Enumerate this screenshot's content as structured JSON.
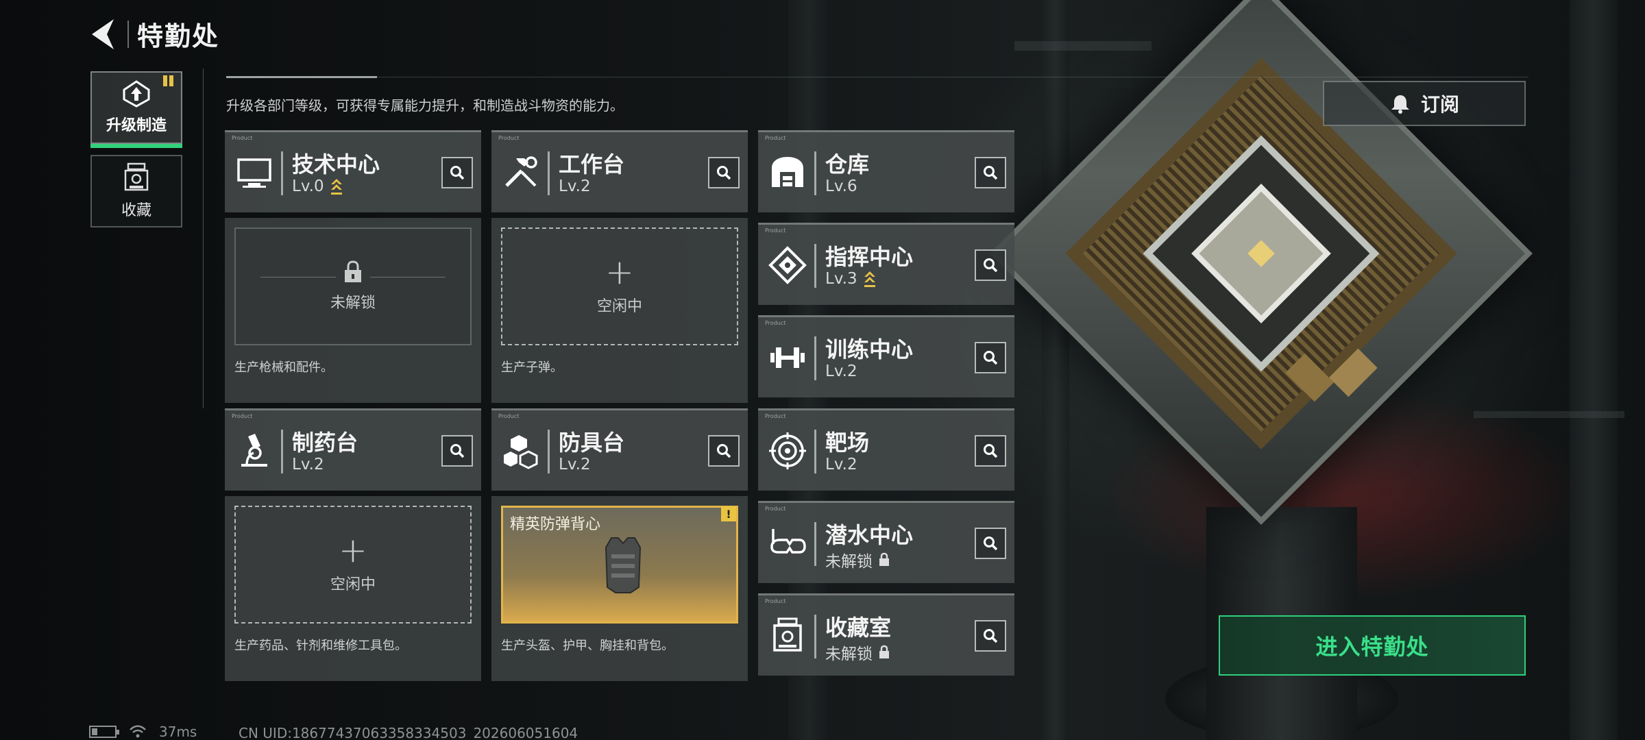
{
  "header": {
    "title": "特勤处"
  },
  "tabs": [
    {
      "label": "升级制造",
      "icon": "upgrade-icon",
      "active": true,
      "badge": true
    },
    {
      "label": "收藏",
      "icon": "collection-icon",
      "active": false
    }
  ],
  "subtitle": "升级各部门等级，可获得专属能力提升，和制造战斗物资的能力。",
  "subscribe": {
    "label": "订阅",
    "icon": "bell-icon"
  },
  "departments": {
    "tech": {
      "name": "技术中心",
      "level": "Lv.0",
      "upgradable": true,
      "slot": {
        "state": "locked",
        "text": "未解锁"
      },
      "desc": "生产枪械和配件。"
    },
    "workbench": {
      "name": "工作台",
      "level": "Lv.2",
      "slot": {
        "state": "idle",
        "plus": "+",
        "text": "空闲中"
      },
      "desc": "生产子弹。"
    },
    "pharmacy": {
      "name": "制药台",
      "level": "Lv.2",
      "slot": {
        "state": "idle",
        "plus": "+",
        "text": "空闲中"
      },
      "desc": "生产药品、针剂和维修工具包。"
    },
    "armory": {
      "name": "防具台",
      "level": "Lv.2",
      "slot": {
        "state": "producing",
        "product": "精英防弹背心",
        "alert": "!"
      },
      "desc": "生产头盔、护甲、胸挂和背包。"
    },
    "warehouse": {
      "name": "仓库",
      "level": "Lv.6"
    },
    "command": {
      "name": "指挥中心",
      "level": "Lv.3",
      "upgradable": true
    },
    "training": {
      "name": "训练中心",
      "level": "Lv.2"
    },
    "range": {
      "name": "靶场",
      "level": "Lv.2"
    },
    "diving": {
      "name": "潜水中心",
      "level": "未解锁",
      "locked": true
    },
    "collection_room": {
      "name": "收藏室",
      "level": "未解锁",
      "locked": true
    }
  },
  "enter_button": {
    "label": "进入特勤处"
  },
  "status_bar": {
    "ping": "37ms",
    "uid": "CN UID:18677437063358334503_202606051604"
  },
  "colors": {
    "accent_green": "#33d27a",
    "gold": "#e7c248"
  }
}
